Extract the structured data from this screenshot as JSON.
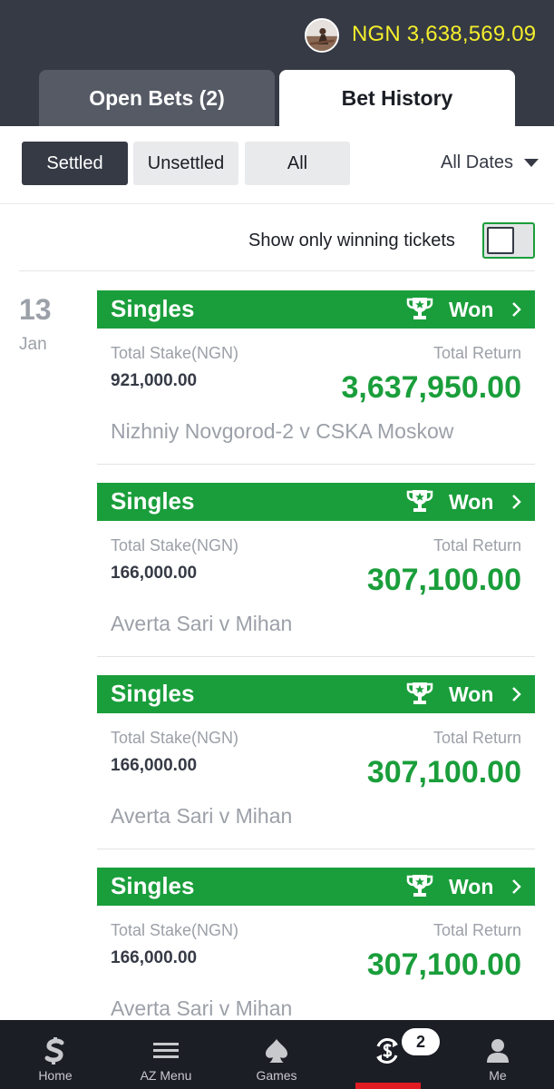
{
  "header": {
    "balance": "NGN 3,638,569.09",
    "tabs": [
      {
        "label": "Open Bets (2)",
        "active": false
      },
      {
        "label": "Bet History",
        "active": true
      }
    ]
  },
  "filters": {
    "buttons": [
      {
        "label": "Settled",
        "active": true
      },
      {
        "label": "Unsettled",
        "active": false
      },
      {
        "label": "All",
        "active": false
      }
    ],
    "dates_label": "All Dates"
  },
  "winning_toggle": {
    "label": "Show only winning tickets",
    "on": false
  },
  "date_group": {
    "day": "13",
    "month": "Jan"
  },
  "tickets": [
    {
      "type": "Singles",
      "status": "Won",
      "stake_label": "Total Stake(NGN)",
      "stake": "921,000.00",
      "return_label": "Total Return",
      "return": "3,637,950.00",
      "match": "Nizhniy Novgorod-2 v CSKA Moskow"
    },
    {
      "type": "Singles",
      "status": "Won",
      "stake_label": "Total Stake(NGN)",
      "stake": "166,000.00",
      "return_label": "Total Return",
      "return": "307,100.00",
      "match": "Averta Sari v Mihan"
    },
    {
      "type": "Singles",
      "status": "Won",
      "stake_label": "Total Stake(NGN)",
      "stake": "166,000.00",
      "return_label": "Total Return",
      "return": "307,100.00",
      "match": "Averta Sari v Mihan"
    },
    {
      "type": "Singles",
      "status": "Won",
      "stake_label": "Total Stake(NGN)",
      "stake": "166,000.00",
      "return_label": "Total Return",
      "return": "307,100.00",
      "match": "Averta Sari v Mihan"
    }
  ],
  "bottom_nav": {
    "items": [
      {
        "label": "Home",
        "icon": "sporty-logo-icon"
      },
      {
        "label": "AZ Menu",
        "icon": "menu-icon"
      },
      {
        "label": "Games",
        "icon": "spade-icon"
      },
      {
        "label": "",
        "icon": "bet-history-icon"
      },
      {
        "label": "Me",
        "icon": "user-icon"
      }
    ],
    "bet_badge": "2"
  },
  "colors": {
    "header_bg": "#353a45",
    "accent_green": "#1a9e3b",
    "balance_yellow": "#f4ee2c",
    "nav_bg": "#1b1e25",
    "active_red": "#e11b22"
  }
}
